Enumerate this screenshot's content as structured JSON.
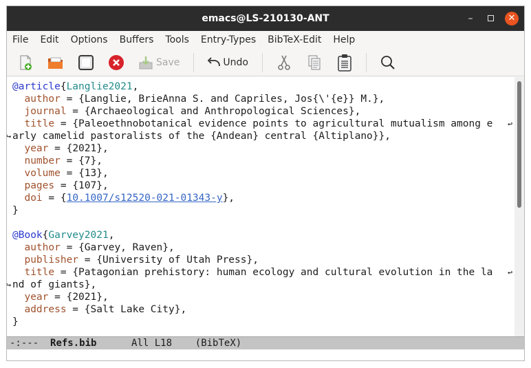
{
  "window": {
    "title": "emacs@LS-210130-ANT",
    "controls": {
      "minimize": "–",
      "close": "✕"
    }
  },
  "menu": [
    "File",
    "Edit",
    "Options",
    "Buffers",
    "Tools",
    "Entry-Types",
    "BibTeX-Edit",
    "Help"
  ],
  "toolbar": {
    "save_label": "Save",
    "undo_label": "Undo",
    "icons": [
      "new-file-icon",
      "open-folder-icon",
      "save-disk-icon",
      "close-buffer-icon",
      "save-icon",
      "undo-icon",
      "cut-icon",
      "copy-icon",
      "paste-icon",
      "search-icon"
    ]
  },
  "buffer": {
    "entry1": {
      "type": "@article",
      "key": "Langlie2021",
      "author_name": "author",
      "author_value": "{Langlie, BrieAnna S. and Capriles, Jos{\\'{e}} M.},",
      "journal_name": "journal",
      "journal_value": "{Archaeological and Anthropological Sciences},",
      "title_name": "title",
      "title_value_1": "{Paleoethnobotanical evidence points to agricultural mutualism among e",
      "title_value_2": "arly camelid pastoralists of the {Andean} central {Altiplano}},",
      "year_name": "year",
      "year_value": "{2021},",
      "number_name": "number",
      "number_value": "{7},",
      "volume_name": "volume",
      "volume_value": "{13},",
      "pages_name": "pages",
      "pages_value": "{107},",
      "doi_name": "doi",
      "doi_value": "10.1007/s12520-021-01343-y",
      "close": "}"
    },
    "entry2": {
      "type": "@Book",
      "key": "Garvey2021",
      "author_name": "author",
      "author_value": "{Garvey, Raven},",
      "publisher_name": "publisher",
      "publisher_value": "{University of Utah Press},",
      "title_name": "title",
      "title_value_1": "{Patagonian prehistory: human ecology and cultural evolution in the la",
      "title_value_2": "nd of giants},",
      "year_name": "year",
      "year_value": "{2021},",
      "address_name": "address",
      "address_value": "{Salt Lake City},",
      "close": "}"
    }
  },
  "modeline": {
    "status": "-:---",
    "buffer_name": "Refs.bib",
    "position": "All L18",
    "mode": "(BibTeX)"
  },
  "colors": {
    "titlebar": "#2c2c2c",
    "close_button": "#e95420",
    "keyword": "#2b3acd",
    "citekey": "#238b8b",
    "field": "#a0522d",
    "link": "#3465c4",
    "modeline": "#c4c4c4"
  }
}
